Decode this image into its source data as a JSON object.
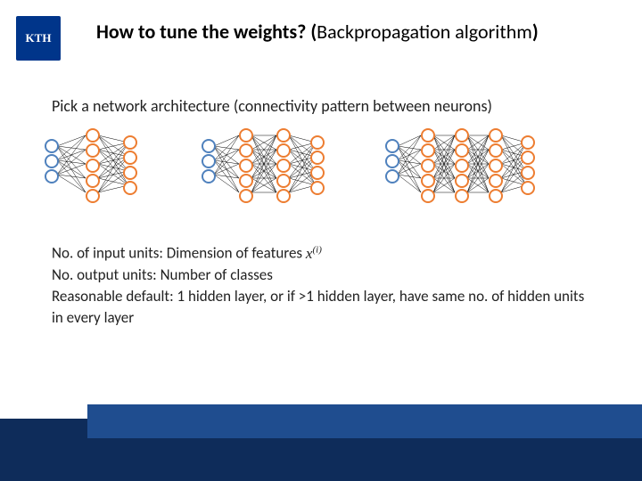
{
  "logo_text": "KTH",
  "title_bold": "How to tune the weights? (",
  "title_sub": "Backpropagation algorithm",
  "title_close": ")",
  "intro": "Pick a network architecture (connectivity pattern between neurons)",
  "rule1_a": "No. of input units: Dimension of features",
  "rule1_math": "x",
  "rule1_sup": "(i)",
  "rule2": "No. output units: Number of classes",
  "rule3": "Reasonable default: 1 hidden layer, or if >1 hidden layer, have same no. of hidden units in every layer"
}
